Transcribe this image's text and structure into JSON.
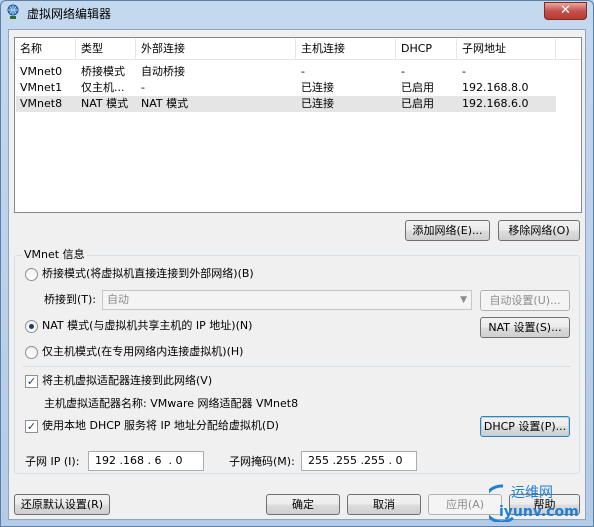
{
  "window": {
    "title": "虚拟网络编辑器",
    "close_glyph": "✕"
  },
  "networks": {
    "headers": [
      "名称",
      "类型",
      "外部连接",
      "主机连接",
      "DHCP",
      "子网地址"
    ],
    "rows": [
      [
        "VMnet0",
        "桥接模式",
        "自动桥接",
        "-",
        "-",
        "-"
      ],
      [
        "VMnet1",
        "仅主机...",
        "-",
        "已连接",
        "已启用",
        "192.168.8.0"
      ],
      [
        "VMnet8",
        "NAT 模式",
        "NAT 模式",
        "已连接",
        "已启用",
        "192.168.6.0"
      ]
    ],
    "selected_row": 2
  },
  "list_buttons": {
    "add": "添加网络(E)...",
    "remove": "移除网络(O)"
  },
  "vmnet_info": {
    "group_label": "VMnet 信息",
    "bridged_label": "桥接模式(将虚拟机直接连接到外部网络)(B)",
    "bridge_to_label": "桥接到(T):",
    "bridge_to_value": "自动",
    "auto_settings": "自动设置(U)...",
    "nat_label": "NAT 模式(与虚拟机共享主机的 IP 地址)(N)",
    "nat_settings": "NAT 设置(S)...",
    "hostonly_label": "仅主机模式(在专用网络内连接虚拟机)(H)",
    "connect_adapter_label": "将主机虚拟适配器连接到此网络(V)",
    "adapter_name_text": "主机虚拟适配器名称: VMware 网络适配器 VMnet8",
    "dhcp_label": "使用本地 DHCP 服务将 IP 地址分配给虚拟机(D)",
    "dhcp_settings": "DHCP 设置(P)...",
    "subnet_ip_label": "子网 IP (I):",
    "subnet_ip_value": "192 .168 . 6  . 0",
    "subnet_mask_label": "子网掩码(M):",
    "subnet_mask_value": "255 .255 .255 . 0",
    "check_glyph": "✓"
  },
  "footer": {
    "restore": "还原默认设置(R)",
    "ok": "确定",
    "cancel": "取消",
    "apply": "应用(A)",
    "help": "帮助"
  },
  "watermark": {
    "top": "运维网",
    "bottom": "iyunv.com"
  },
  "colors": {
    "selected_row": "#e5e5e5",
    "watermark": "#1e7fd6"
  }
}
